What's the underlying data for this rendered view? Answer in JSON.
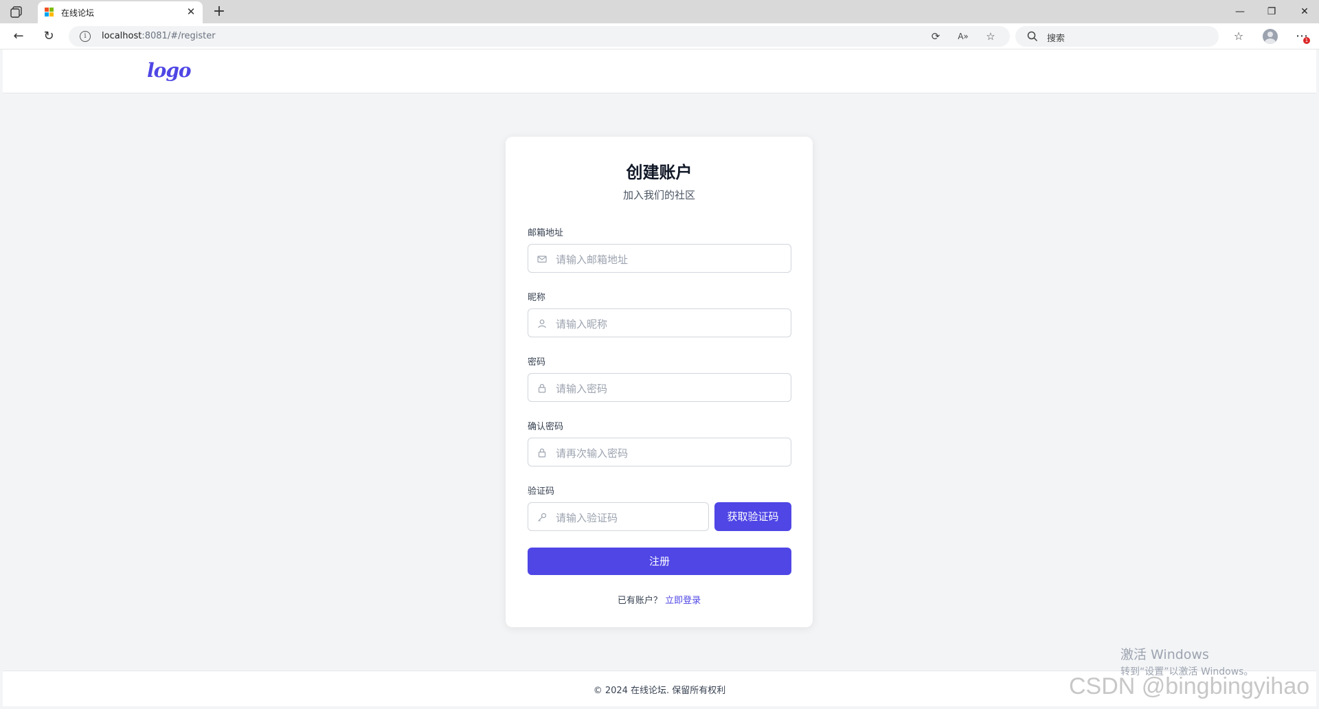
{
  "browser": {
    "tab_title": "在线论坛",
    "url_host": "localhost",
    "url_path": ":8081/#/register",
    "search_placeholder": "搜索",
    "notification_count": "1"
  },
  "header": {
    "logo_text": "logo"
  },
  "form": {
    "title": "创建账户",
    "subtitle": "加入我们的社区",
    "email": {
      "label": "邮箱地址",
      "placeholder": "请输入邮箱地址"
    },
    "nickname": {
      "label": "昵称",
      "placeholder": "请输入昵称"
    },
    "password": {
      "label": "密码",
      "placeholder": "请输入密码"
    },
    "confirm_password": {
      "label": "确认密码",
      "placeholder": "请再次输入密码"
    },
    "captcha": {
      "label": "验证码",
      "placeholder": "请输入验证码",
      "button_label": "获取验证码"
    },
    "submit_label": "注册",
    "have_account_text": "已有账户？",
    "login_link_label": "立即登录"
  },
  "footer": {
    "copyright": "© 2024 在线论坛. 保留所有权利"
  },
  "overlay": {
    "activate_title": "激活 Windows",
    "activate_hint": "转到“设置”以激活 Windows。",
    "watermark": "CSDN @bingbingyihao"
  },
  "colors": {
    "accent": "#4f46e5",
    "background": "#f3f4f6",
    "card": "#ffffff"
  }
}
